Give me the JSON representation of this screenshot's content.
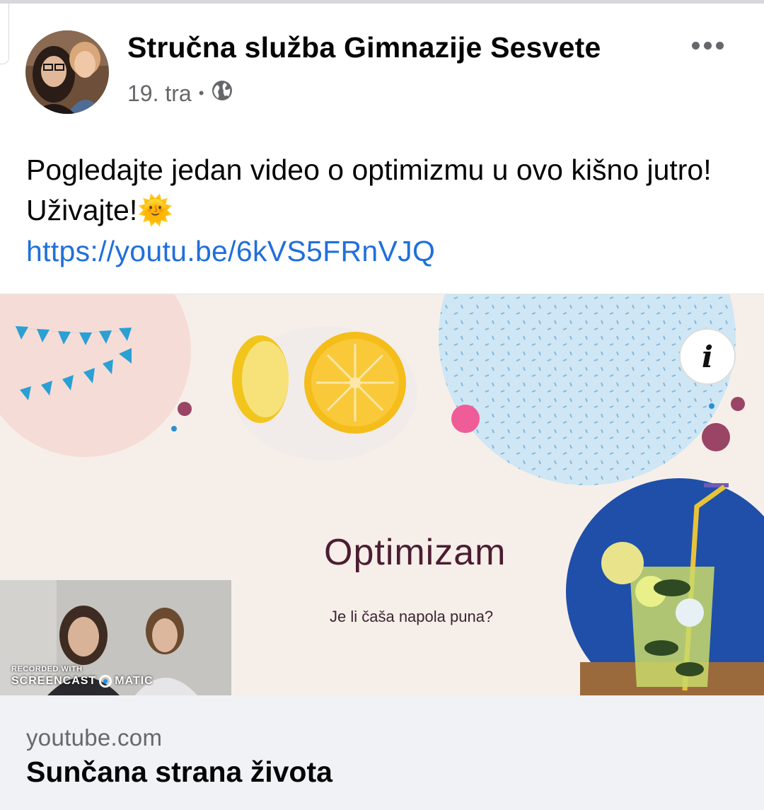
{
  "post": {
    "author": "Stručna služba Gimnazije Sesvete",
    "date": "19. tra",
    "separator": "•",
    "audience_icon": "globe-icon",
    "more_icon": "more-options-icon",
    "text": "Pogledajte jedan video o optimizmu u ovo kišno jutro! Uživajte!🌞",
    "link": "https://youtu.be/6kVS5FRnVJQ"
  },
  "preview": {
    "slide_title": "Optimizam",
    "slide_subtitle": "Je li čaša napola puna?",
    "info_icon": "info-icon",
    "info_label": "i",
    "watermark_line1": "RECORDED WITH",
    "watermark_left": "SCREENCAST",
    "watermark_right": "MATIC",
    "domain": "youtube.com",
    "title": "Sunčana strana života"
  },
  "colors": {
    "link": "#216fdb",
    "secondary_text": "#65676b",
    "slide_title": "#4b1d32",
    "caption_bg": "#f0f2f5"
  }
}
